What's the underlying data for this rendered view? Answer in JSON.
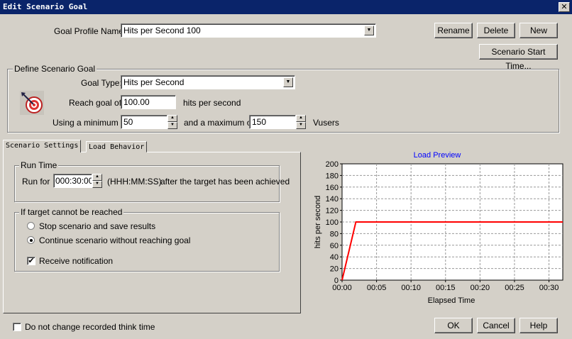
{
  "window": {
    "title": "Edit Scenario Goal",
    "close_glyph": "✕"
  },
  "goal_profile": {
    "label": "Goal Profile Name:",
    "value": "Hits per Second 100"
  },
  "buttons": {
    "rename": "Rename",
    "delete": "Delete",
    "new": "New",
    "start_time": "Scenario Start Time...",
    "ok": "OK",
    "cancel": "Cancel",
    "help": "Help"
  },
  "define_goal": {
    "title": "Define Scenario Goal",
    "goal_type_label": "Goal Type:",
    "goal_type_value": "Hits per Second",
    "reach_label": "Reach goal of",
    "reach_value": "100.00",
    "reach_unit": "hits per second",
    "min_label": "Using a minimum of",
    "min_value": "50",
    "max_label": "and a maximum of",
    "max_value": "150",
    "vusers_label": "Vusers"
  },
  "tabs": [
    "Scenario Settings",
    "Load Behavior"
  ],
  "run_time": {
    "title": "Run Time",
    "run_for_label": "Run for",
    "run_for_value": "000:30:00",
    "format": "(HHH:MM:SS)",
    "after_text": "after the target has been achieved"
  },
  "unreached": {
    "title": "If target cannot be reached",
    "option_stop": "Stop scenario and save results",
    "option_continue": "Continue scenario without reaching goal",
    "selected": "continue",
    "notify_label": "Receive notification",
    "notify_checked": true
  },
  "think_time": {
    "label": "Do not change recorded think time",
    "checked": false
  },
  "chart_data": {
    "type": "line",
    "title": "Load Preview",
    "xlabel": "Elapsed Time",
    "ylabel": "hits per second",
    "xlim": [
      0,
      32
    ],
    "ylim": [
      0,
      200
    ],
    "x_ticks": [
      "00:00",
      "00:05",
      "00:10",
      "00:15",
      "00:20",
      "00:25",
      "00:30"
    ],
    "y_ticks": [
      "0",
      "20",
      "40",
      "60",
      "80",
      "100",
      "120",
      "140",
      "160",
      "180",
      "200"
    ],
    "grid": true,
    "series": [
      {
        "color": "#ff0000",
        "x": [
          0,
          2,
          32
        ],
        "y": [
          0,
          100,
          100
        ]
      }
    ],
    "title_color": "#0000ff"
  }
}
